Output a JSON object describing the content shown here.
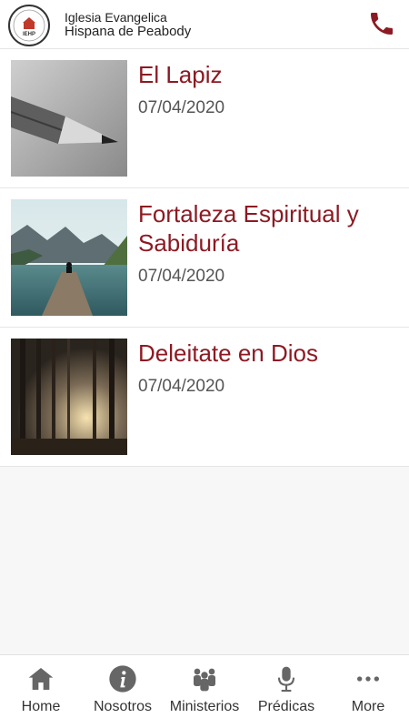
{
  "header": {
    "brand_line1": "Iglesia Evangelica",
    "brand_line2": "Hispana de Peabody",
    "logo_text": "IEHP",
    "accent_color": "#8c1a23"
  },
  "posts": [
    {
      "title": "El Lapiz",
      "date": "07/04/2020",
      "image": "pencil-photo"
    },
    {
      "title": "Fortaleza Espiritual y Sabiduría",
      "date": "07/04/2020",
      "image": "lake-dock-photo"
    },
    {
      "title": "Deleitate en Dios",
      "date": "07/04/2020",
      "image": "forest-sunlight-photo"
    }
  ],
  "tabs": [
    {
      "label": "Home",
      "icon": "home-icon"
    },
    {
      "label": "Nosotros",
      "icon": "info-icon"
    },
    {
      "label": "Ministerios",
      "icon": "people-icon"
    },
    {
      "label": "Prédicas",
      "icon": "microphone-icon"
    },
    {
      "label": "More",
      "icon": "more-icon"
    }
  ]
}
